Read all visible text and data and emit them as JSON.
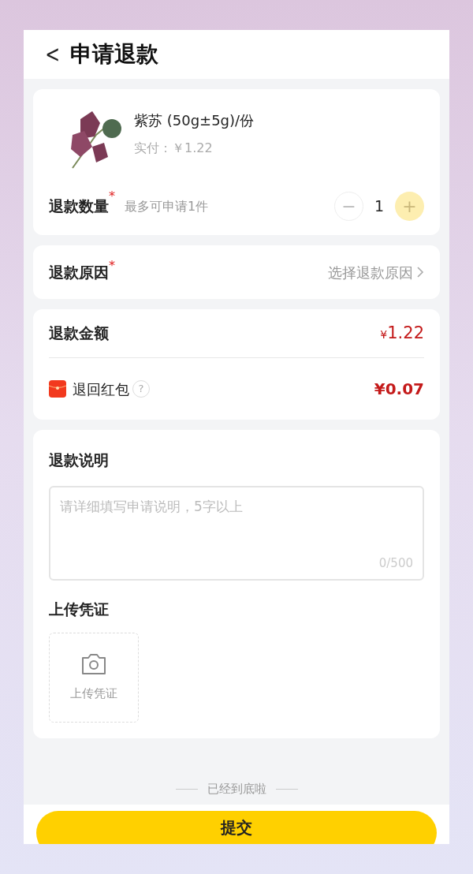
{
  "header": {
    "back": "<",
    "title": "申请退款"
  },
  "product": {
    "name": "紫苏 (50g±5g)/份",
    "paid": "实付：￥1.22"
  },
  "quantity": {
    "label": "退款数量",
    "required_mark": "*",
    "hint": "最多可申请1件",
    "value": "1",
    "minus": {
      "symbol": "−",
      "disabled": true
    },
    "plus": {
      "symbol": "+",
      "disabled": true
    }
  },
  "reason": {
    "label": "退款原因",
    "required_mark": "*",
    "placeholder": "选择退款原因"
  },
  "amount": {
    "label": "退款金额",
    "currency": "¥",
    "value": "1.22"
  },
  "red_packet": {
    "label": "退回红包",
    "help": "?",
    "value": "¥0.07"
  },
  "explanation": {
    "label": "退款说明",
    "placeholder": "请详细填写申请说明，5字以上",
    "counter": "0/500"
  },
  "upload": {
    "label": "上传凭证",
    "button": "上传凭证"
  },
  "end_note": "已经到底啦",
  "submit": "提交"
}
